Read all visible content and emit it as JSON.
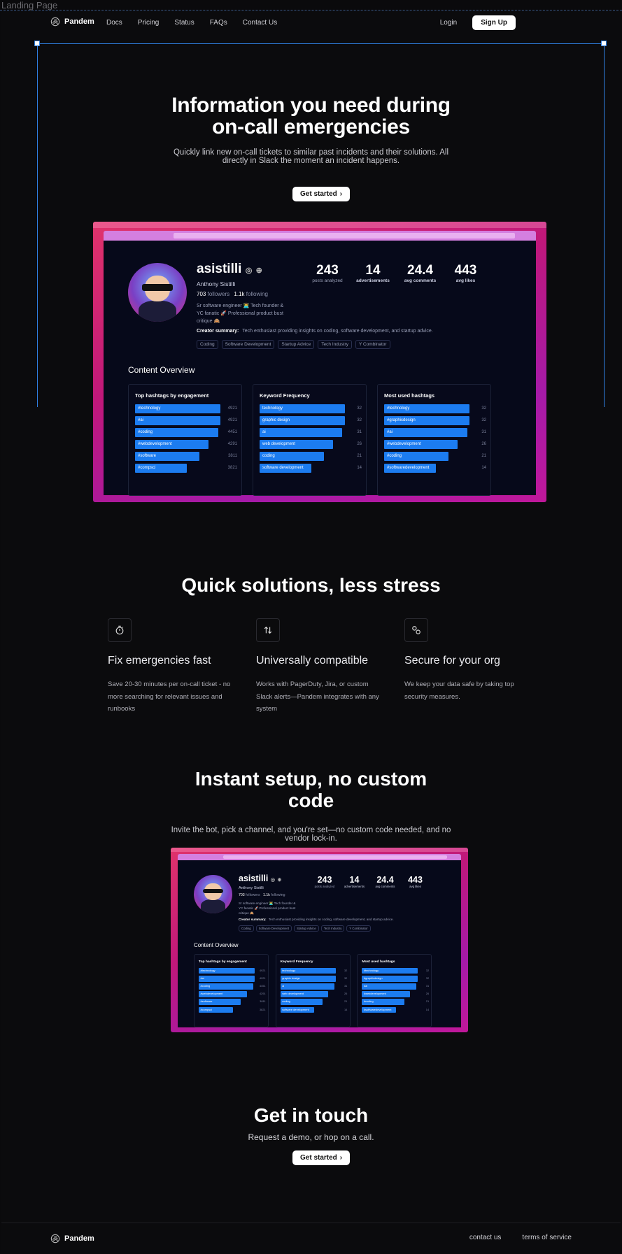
{
  "canvas": {
    "frame_label": "Landing Page"
  },
  "nav": {
    "brand": "Pandem",
    "links": [
      "Docs",
      "Pricing",
      "Status",
      "FAQs",
      "Contact Us"
    ],
    "login": "Login",
    "signup": "Sign Up"
  },
  "hero": {
    "title_line1": "Information you need during",
    "title_line2": "on-call emergencies",
    "subtitle": "Quickly link new on-call tickets to similar past incidents and their solutions. All directly in Slack the moment an incident happens.",
    "cta": "Get started"
  },
  "profile": {
    "username": "asistilli",
    "display_name": "Anthony Sistilli",
    "followers_count": "703",
    "followers_label": "followers",
    "following_count": "1.1k",
    "following_label": "following",
    "bio_line1": "Sr software engineer 👨‍💻 Tech founder &",
    "bio_line2": "YC fanatic 🚀 Professional product bust",
    "bio_line3": "critique 🙈",
    "summary_label": "Creator summary:",
    "summary_text": "Tech enthusiast providing insights on coding, software development, and startup advice.",
    "chips": [
      "Coding",
      "Software Development",
      "Startup Advice",
      "Tech Industry",
      "Y Combinator"
    ],
    "stats": [
      {
        "value": "243",
        "label": "posts analyzed"
      },
      {
        "value": "14",
        "label": "advertisements"
      },
      {
        "value": "24.4",
        "label": "avg comments"
      },
      {
        "value": "443",
        "label": "avg likes"
      }
    ],
    "overview_title": "Content Overview",
    "cards": [
      {
        "title": "Top hashtags by engagement",
        "rows": [
          {
            "label": "#technology",
            "value": "4921",
            "pct": 0.95
          },
          {
            "label": "#ai",
            "value": "4921",
            "pct": 0.95
          },
          {
            "label": "#coding",
            "value": "4451",
            "pct": 0.93
          },
          {
            "label": "#webdevelopment",
            "value": "4291",
            "pct": 0.82
          },
          {
            "label": "#software",
            "value": "3811",
            "pct": 0.72
          },
          {
            "label": "#compsci",
            "value": "3821",
            "pct": 0.58
          }
        ]
      },
      {
        "title": "Keyword Frequency",
        "rows": [
          {
            "label": "technology",
            "value": "32",
            "pct": 0.95
          },
          {
            "label": "graphic design",
            "value": "32",
            "pct": 0.95
          },
          {
            "label": "ai",
            "value": "31",
            "pct": 0.92
          },
          {
            "label": "web development",
            "value": "26",
            "pct": 0.82
          },
          {
            "label": "coding",
            "value": "21",
            "pct": 0.72
          },
          {
            "label": "software development",
            "value": "14",
            "pct": 0.58
          }
        ]
      },
      {
        "title": "Most used hashtags",
        "rows": [
          {
            "label": "#technology",
            "value": "32",
            "pct": 0.95
          },
          {
            "label": "#graphicdesign",
            "value": "32",
            "pct": 0.95
          },
          {
            "label": "#ai",
            "value": "31",
            "pct": 0.93
          },
          {
            "label": "#webdevelopment",
            "value": "26",
            "pct": 0.82
          },
          {
            "label": "#coding",
            "value": "21",
            "pct": 0.72
          },
          {
            "label": "#softwaredevelopment",
            "value": "14",
            "pct": 0.58
          }
        ]
      }
    ]
  },
  "features": {
    "title": "Quick solutions, less stress",
    "items": [
      {
        "icon": "stopwatch-icon",
        "title": "Fix emergencies fast",
        "text": "Save 20-30 minutes per on-call ticket - no more searching for relevant issues and runbooks"
      },
      {
        "icon": "arrows-up-down-icon",
        "title": "Universally compatible",
        "text": "Works with PagerDuty, Jira, or custom Slack alerts—Pandem integrates with any system"
      },
      {
        "icon": "link-icon",
        "title": "Secure for your org",
        "text": "We keep your data safe by taking top security measures."
      }
    ]
  },
  "setup": {
    "title_line1": "Instant setup, no custom",
    "title_line2": "code",
    "subtitle": "Invite the bot, pick a channel, and you're set—no custom code needed, and no vendor lock-in."
  },
  "contact": {
    "title": "Get in touch",
    "subtitle": "Request a demo, or hop on a call.",
    "cta": "Get started"
  },
  "footer": {
    "brand": "Pandem",
    "contact": "contact us",
    "terms": "terms of service"
  },
  "colors": {
    "accent_bar": "#1c7cf0",
    "selection": "#2f7fe0"
  }
}
